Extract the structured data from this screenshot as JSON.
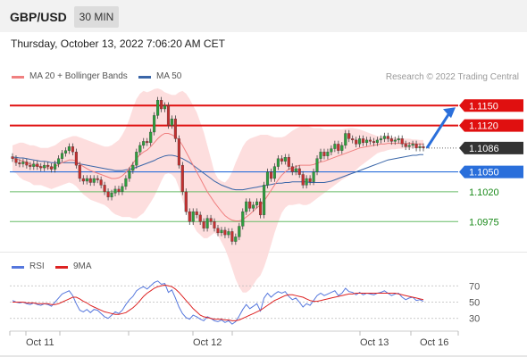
{
  "header": {
    "symbol": "GBP/USD",
    "timeframe": "30 MIN",
    "datetime": "Thursday, October 13, 2022 7:06:20 AM CET",
    "credit": "Research © 2022 Trading Central"
  },
  "legend": {
    "ma20": "MA 20 + Bollinger Bands",
    "ma50": "MA 50",
    "rsi": "RSI",
    "ma9": "9MA"
  },
  "colors": {
    "resistance": "#e01010",
    "support": "#2a6fdb",
    "current": "#333333",
    "target": "#66bb66",
    "bollinger": "#fdd8d8",
    "ma20": "#f08080",
    "ma50": "#3a66a8",
    "up_candle": "#2e9e3e",
    "down_candle": "#c43030",
    "rsi": "#5577dd",
    "rsi_ma": "#dd2222",
    "arrow": "#2a6fdb"
  },
  "chart_data": [
    {
      "type": "candlestick",
      "title": "GBP/USD",
      "x_labels": [
        "Oct 11",
        "Oct 12",
        "Oct 13",
        "Oct 16"
      ],
      "ylim": [
        1.0935,
        1.118
      ],
      "levels": [
        {
          "label": "1.1150",
          "value": 1.115,
          "kind": "resistance"
        },
        {
          "label": "1.1120",
          "value": 1.112,
          "kind": "resistance"
        },
        {
          "label": "1.1086",
          "value": 1.1086,
          "kind": "current"
        },
        {
          "label": "1.1050",
          "value": 1.105,
          "kind": "support"
        },
        {
          "label": "1.1020",
          "value": 1.102,
          "kind": "target"
        },
        {
          "label": "1.0975",
          "value": 1.0975,
          "kind": "target"
        }
      ],
      "close": [
        1.107,
        1.1064,
        1.1062,
        1.1065,
        1.106,
        1.1058,
        1.1062,
        1.1058,
        1.1056,
        1.106,
        1.1058,
        1.1054,
        1.1062,
        1.107,
        1.1078,
        1.1082,
        1.1088,
        1.108,
        1.106,
        1.104,
        1.1036,
        1.104,
        1.1034,
        1.104,
        1.1038,
        1.103,
        1.102,
        1.1012,
        1.1018,
        1.1024,
        1.102,
        1.1028,
        1.104,
        1.1052,
        1.106,
        1.108,
        1.109,
        1.1096,
        1.1094,
        1.111,
        1.1135,
        1.1158,
        1.1145,
        1.115,
        1.112,
        1.113,
        1.11,
        1.106,
        1.102,
        1.099,
        1.0975,
        1.099,
        1.0985,
        1.0975,
        1.0965,
        1.098,
        1.0975,
        1.0965,
        1.0958,
        1.0962,
        1.0955,
        1.096,
        1.0945,
        1.0952,
        1.0968,
        1.099,
        1.1005,
        1.0995,
        1.1,
        1.1005,
        1.0985,
        1.103,
        1.105,
        1.104,
        1.1058,
        1.107,
        1.1066,
        1.1072,
        1.1058,
        1.105,
        1.1055,
        1.1046,
        1.103,
        1.104,
        1.1035,
        1.105,
        1.107,
        1.108,
        1.1074,
        1.108,
        1.1085,
        1.1092,
        1.1082,
        1.109,
        1.1108,
        1.11,
        1.1098,
        1.1092,
        1.11,
        1.1094,
        1.1098,
        1.1096,
        1.1094,
        1.1098,
        1.11,
        1.1104,
        1.11,
        1.1096,
        1.1098,
        1.11,
        1.1092,
        1.1088,
        1.109,
        1.1092,
        1.1086,
        1.1088,
        1.1086
      ],
      "bb_upper": [
        1.109,
        1.1092,
        1.1094,
        1.1094,
        1.1092,
        1.109,
        1.109,
        1.1088,
        1.1086,
        1.1086,
        1.1086,
        1.1088,
        1.109,
        1.1094,
        1.1098,
        1.11,
        1.1102,
        1.1104,
        1.1104,
        1.1102,
        1.11,
        1.1098,
        1.1096,
        1.1094,
        1.1092,
        1.109,
        1.1088,
        1.1088,
        1.109,
        1.1094,
        1.1098,
        1.1106,
        1.1116,
        1.113,
        1.1146,
        1.116,
        1.1168,
        1.1172,
        1.117,
        1.1172,
        1.1175,
        1.1176,
        1.1174,
        1.117,
        1.1168,
        1.1166,
        1.1166,
        1.117,
        1.1172,
        1.1168,
        1.116,
        1.115,
        1.114,
        1.1125,
        1.111,
        1.109,
        1.107,
        1.105,
        1.104,
        1.1036,
        1.1034,
        1.104,
        1.105,
        1.1064,
        1.1076,
        1.1088,
        1.1096,
        1.11,
        1.1102,
        1.1104,
        1.1106,
        1.1106,
        1.1106,
        1.1104,
        1.1102,
        1.1102,
        1.1102,
        1.1104,
        1.1108,
        1.1112,
        1.1115,
        1.1118,
        1.112,
        1.112,
        1.1118,
        1.1116,
        1.1116,
        1.1116,
        1.1114,
        1.1114,
        1.1114,
        1.1114,
        1.1114,
        1.1114,
        1.1115,
        1.1116,
        1.1116,
        1.1115,
        1.1114,
        1.1112,
        1.111,
        1.1108,
        1.1106,
        1.1104,
        1.1104,
        1.1103,
        1.1103,
        1.1102,
        1.1102,
        1.1101,
        1.1101,
        1.11,
        1.11,
        1.1099,
        1.1099,
        1.1098,
        1.1098
      ],
      "ma20": [
        1.107,
        1.107,
        1.1068,
        1.1066,
        1.1064,
        1.1062,
        1.106,
        1.1059,
        1.1058,
        1.1057,
        1.1056,
        1.1056,
        1.1058,
        1.1061,
        1.1064,
        1.1066,
        1.1068,
        1.1068,
        1.1066,
        1.1062,
        1.1058,
        1.1055,
        1.1052,
        1.105,
        1.1048,
        1.1046,
        1.1044,
        1.1042,
        1.104,
        1.104,
        1.1041,
        1.1044,
        1.1049,
        1.1056,
        1.1063,
        1.107,
        1.1076,
        1.108,
        1.1083,
        1.1088,
        1.1094,
        1.11,
        1.1105,
        1.1108,
        1.1108,
        1.1106,
        1.1103,
        1.1098,
        1.109,
        1.108,
        1.107,
        1.106,
        1.105,
        1.104,
        1.103,
        1.102,
        1.1012,
        1.1004,
        1.0997,
        1.099,
        1.0984,
        1.098,
        1.0977,
        1.0976,
        1.0976,
        1.0978,
        1.0982,
        1.0986,
        1.0991,
        1.0996,
        1.1,
        1.1006,
        1.1014,
        1.1022,
        1.103,
        1.1038,
        1.1045,
        1.105,
        1.1054,
        1.1056,
        1.1058,
        1.106,
        1.106,
        1.106,
        1.106,
        1.1061,
        1.1063,
        1.1065,
        1.1066,
        1.1068,
        1.107,
        1.1072,
        1.1074,
        1.1076,
        1.1078,
        1.108,
        1.1082,
        1.1084,
        1.1086,
        1.1087,
        1.1088,
        1.1089,
        1.109,
        1.1091,
        1.1092,
        1.1092,
        1.1093,
        1.1093,
        1.1093,
        1.1093,
        1.1093,
        1.1093,
        1.1093,
        1.1093,
        1.1092,
        1.1092,
        1.1092
      ],
      "bb_lower": [
        1.105,
        1.1048,
        1.1042,
        1.1038,
        1.1036,
        1.1034,
        1.103,
        1.103,
        1.103,
        1.1028,
        1.1026,
        1.1024,
        1.1026,
        1.1028,
        1.103,
        1.1032,
        1.1034,
        1.1032,
        1.1028,
        1.1022,
        1.1016,
        1.1012,
        1.1008,
        1.1006,
        1.1004,
        1.1002,
        1.1,
        1.0996,
        1.099,
        1.0986,
        1.0984,
        1.0982,
        1.0982,
        1.0982,
        1.098,
        1.098,
        1.0984,
        1.0988,
        1.0996,
        1.1004,
        1.1013,
        1.1024,
        1.1036,
        1.1046,
        1.1048,
        1.1046,
        1.104,
        1.1026,
        1.1008,
        1.0992,
        1.098,
        1.097,
        1.096,
        1.0955,
        1.095,
        1.095,
        1.0954,
        1.0958,
        1.0954,
        1.0944,
        1.0934,
        1.092,
        1.0904,
        1.0888,
        1.0876,
        1.0868,
        1.0868,
        1.0872,
        1.088,
        1.0888,
        1.0894,
        1.0906,
        1.0922,
        1.094,
        1.0958,
        1.0974,
        1.0988,
        1.0996,
        1.1,
        1.1,
        1.1001,
        1.1002,
        1.1,
        1.1,
        1.1002,
        1.1006,
        1.101,
        1.1014,
        1.1018,
        1.1022,
        1.1026,
        1.103,
        1.1034,
        1.1038,
        1.1041,
        1.1044,
        1.1048,
        1.1053,
        1.1058,
        1.1062,
        1.1066,
        1.107,
        1.1074,
        1.1078,
        1.108,
        1.1081,
        1.1083,
        1.1084,
        1.1084,
        1.1085,
        1.1085,
        1.1086,
        1.1085,
        1.1086,
        1.1086,
        1.1086,
        1.1086
      ],
      "ma50": [
        1.1072,
        1.1072,
        1.1071,
        1.1071,
        1.107,
        1.1069,
        1.1068,
        1.1067,
        1.1066,
        1.1066,
        1.1065,
        1.1064,
        1.1064,
        1.1064,
        1.1064,
        1.1064,
        1.1064,
        1.1064,
        1.1063,
        1.1062,
        1.1061,
        1.106,
        1.1059,
        1.1058,
        1.1057,
        1.1056,
        1.1055,
        1.1054,
        1.1053,
        1.1052,
        1.1052,
        1.1052,
        1.1053,
        1.1054,
        1.1055,
        1.1057,
        1.1059,
        1.1061,
        1.1063,
        1.1065,
        1.1067,
        1.107,
        1.1072,
        1.1074,
        1.1075,
        1.1075,
        1.1074,
        1.1072,
        1.107,
        1.1067,
        1.1064,
        1.106,
        1.1056,
        1.1052,
        1.1048,
        1.1044,
        1.104,
        1.1036,
        1.1033,
        1.103,
        1.1028,
        1.1026,
        1.1024,
        1.1023,
        1.1023,
        1.1023,
        1.1024,
        1.1025,
        1.1026,
        1.1027,
        1.1028,
        1.1029,
        1.103,
        1.1031,
        1.1032,
        1.1033,
        1.1033,
        1.1034,
        1.1034,
        1.1035,
        1.1035,
        1.1035,
        1.1035,
        1.1035,
        1.1034,
        1.1034,
        1.1034,
        1.1034,
        1.1034,
        1.1035,
        1.1036,
        1.1038,
        1.104,
        1.1042,
        1.1044,
        1.1046,
        1.1048,
        1.105,
        1.1052,
        1.1054,
        1.1056,
        1.1058,
        1.106,
        1.1062,
        1.1064,
        1.1066,
        1.1068,
        1.1069,
        1.107,
        1.1071,
        1.1072,
        1.1073,
        1.1074,
        1.1075,
        1.1075,
        1.1076,
        1.1076
      ],
      "projection": {
        "from": 1.1086,
        "to": 1.115
      }
    },
    {
      "type": "line",
      "title": "RSI",
      "ylim": [
        22,
        78
      ],
      "y_ticks": [
        70,
        50,
        30
      ],
      "series": [
        {
          "name": "RSI",
          "values": [
            52,
            50,
            49,
            50,
            48,
            47,
            49,
            47,
            46,
            48,
            47,
            45,
            50,
            55,
            60,
            62,
            64,
            58,
            48,
            40,
            38,
            41,
            37,
            41,
            40,
            36,
            32,
            30,
            34,
            38,
            36,
            40,
            47,
            53,
            57,
            64,
            67,
            69,
            66,
            70,
            74,
            76,
            72,
            73,
            62,
            65,
            55,
            44,
            36,
            31,
            29,
            34,
            32,
            29,
            27,
            32,
            30,
            27,
            26,
            28,
            25,
            27,
            23,
            26,
            33,
            41,
            47,
            42,
            45,
            48,
            39,
            55,
            61,
            56,
            60,
            63,
            61,
            63,
            57,
            53,
            55,
            50,
            44,
            48,
            46,
            52,
            58,
            61,
            58,
            60,
            62,
            64,
            58,
            61,
            67,
            63,
            62,
            59,
            62,
            59,
            61,
            60,
            59,
            61,
            62,
            64,
            61,
            58,
            60,
            61,
            56,
            53,
            55,
            56,
            52,
            53,
            51
          ]
        },
        {
          "name": "9MA",
          "values": [
            50,
            50,
            50,
            50,
            49,
            49,
            49,
            48,
            48,
            48,
            48,
            47,
            47,
            48,
            50,
            52,
            54,
            56,
            56,
            54,
            51,
            49,
            46,
            44,
            42,
            40,
            38,
            37,
            36,
            35,
            35,
            36,
            37,
            40,
            43,
            47,
            52,
            57,
            61,
            64,
            67,
            69,
            70,
            71,
            70,
            69,
            66,
            62,
            57,
            52,
            47,
            42,
            38,
            34,
            32,
            31,
            30,
            29,
            29,
            29,
            28,
            28,
            27,
            27,
            28,
            30,
            32,
            34,
            36,
            38,
            40,
            43,
            46,
            49,
            52,
            54,
            56,
            58,
            59,
            59,
            58,
            57,
            56,
            54,
            52,
            51,
            51,
            52,
            53,
            54,
            55,
            56,
            57,
            58,
            59,
            60,
            60,
            61,
            61,
            61,
            61,
            61,
            61,
            61,
            61,
            61,
            61,
            61,
            61,
            60,
            59,
            58,
            57,
            56,
            55,
            54,
            53
          ]
        }
      ]
    }
  ]
}
